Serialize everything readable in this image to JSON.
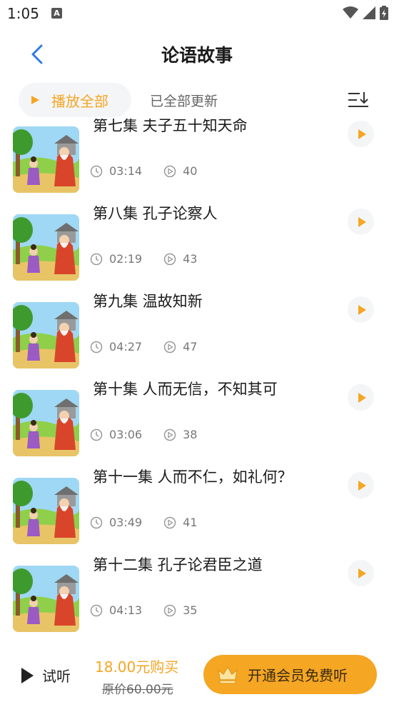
{
  "status_bar": {
    "time": "1:05",
    "notification_icon": "A"
  },
  "header": {
    "title": "论语故事",
    "back_icon": "chevron-left-icon"
  },
  "controls": {
    "play_all_label": "播放全部",
    "update_status": "已全部更新",
    "sort_icon": "sort-icon"
  },
  "episodes": [
    {
      "title": "第七集 夫子五十知天命",
      "duration": "03:14",
      "plays": "40"
    },
    {
      "title": "第八集 孔子论察人",
      "duration": "02:19",
      "plays": "43"
    },
    {
      "title": "第九集 温故知新",
      "duration": "04:27",
      "plays": "47"
    },
    {
      "title": "第十集 人而无信，不知其可",
      "duration": "03:06",
      "plays": "38"
    },
    {
      "title": "第十一集  人而不仁，如礼何？",
      "duration": "03:49",
      "plays": "41"
    },
    {
      "title": "第十二集  孔子论君臣之道",
      "duration": "04:13",
      "plays": "35"
    }
  ],
  "bottom_bar": {
    "trial_label": "试听",
    "price": "18.00元购买",
    "original_price": "原价60.00元",
    "vip_label": "开通会员免费听"
  },
  "colors": {
    "accent": "#f5a623",
    "back_arrow": "#2f7ae5",
    "chip_bg": "#f4f5f7"
  }
}
